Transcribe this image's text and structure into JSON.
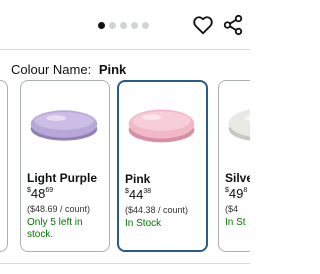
{
  "carousel": {
    "dot_count": 5,
    "active_index": 0
  },
  "colour": {
    "label": "Colour Name:",
    "value": "Pink"
  },
  "swatches": [
    {
      "name": "",
      "price_symbol": "",
      "price_whole": "",
      "price_fraction": "",
      "unit_price": "",
      "stock": ""
    },
    {
      "name": "Light Purple",
      "price_symbol": "$",
      "price_whole": "48",
      "price_fraction": "69",
      "unit_price": "($48.69 / count)",
      "stock": "Only 5 left in stock.",
      "swatch_color": "#b8a8d8"
    },
    {
      "name": "Pink",
      "price_symbol": "$",
      "price_whole": "44",
      "price_fraction": "38",
      "unit_price": "($44.38 / count)",
      "stock": "In Stock",
      "swatch_color": "#f2b8c8",
      "selected": true
    },
    {
      "name": "Silve",
      "price_symbol": "$",
      "price_whole": "49",
      "price_fraction": "8",
      "unit_price": "($4",
      "stock": "In St",
      "swatch_color": "#e8e8e4"
    }
  ],
  "icons": {
    "heart": "heart-icon",
    "share": "share-icon"
  },
  "colors": {
    "selected_border": "#2b5a8c",
    "in_stock": "#007600"
  }
}
